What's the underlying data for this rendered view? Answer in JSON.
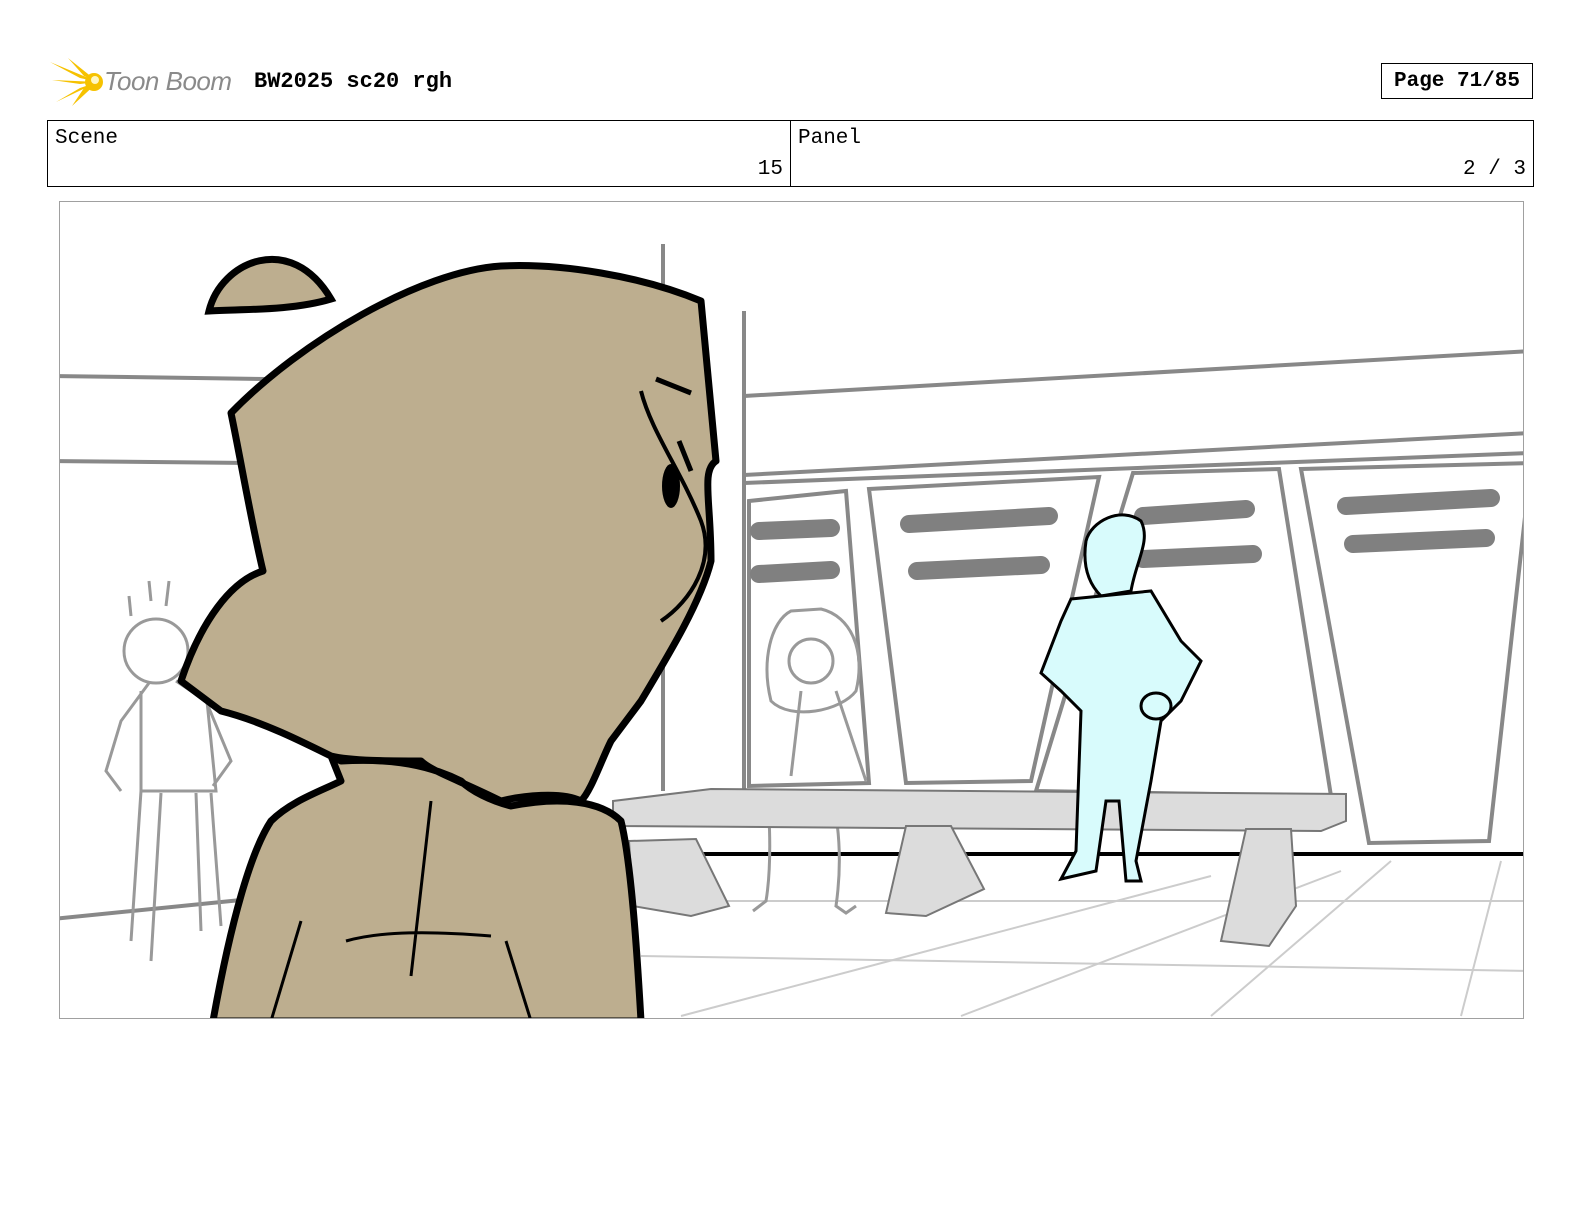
{
  "header": {
    "logo_text": "Toon Boom",
    "document_title": "BW2025 sc20 rgh",
    "page_label": "Page 71/85"
  },
  "info": {
    "scene_label": "Scene",
    "scene_value": "15",
    "panel_label": "Panel",
    "panel_value": "2 / 3"
  },
  "colors": {
    "logo_flare": "#f6c200",
    "character_fill": "#bdae8f",
    "blue_character_fill": "#d8fbfc",
    "bench_fill": "#dcdcdc",
    "locker_bar": "#808080",
    "panel_border": "#a0a0a0"
  },
  "panel_drawing": {
    "description_icon": "storyboard-sketch"
  }
}
